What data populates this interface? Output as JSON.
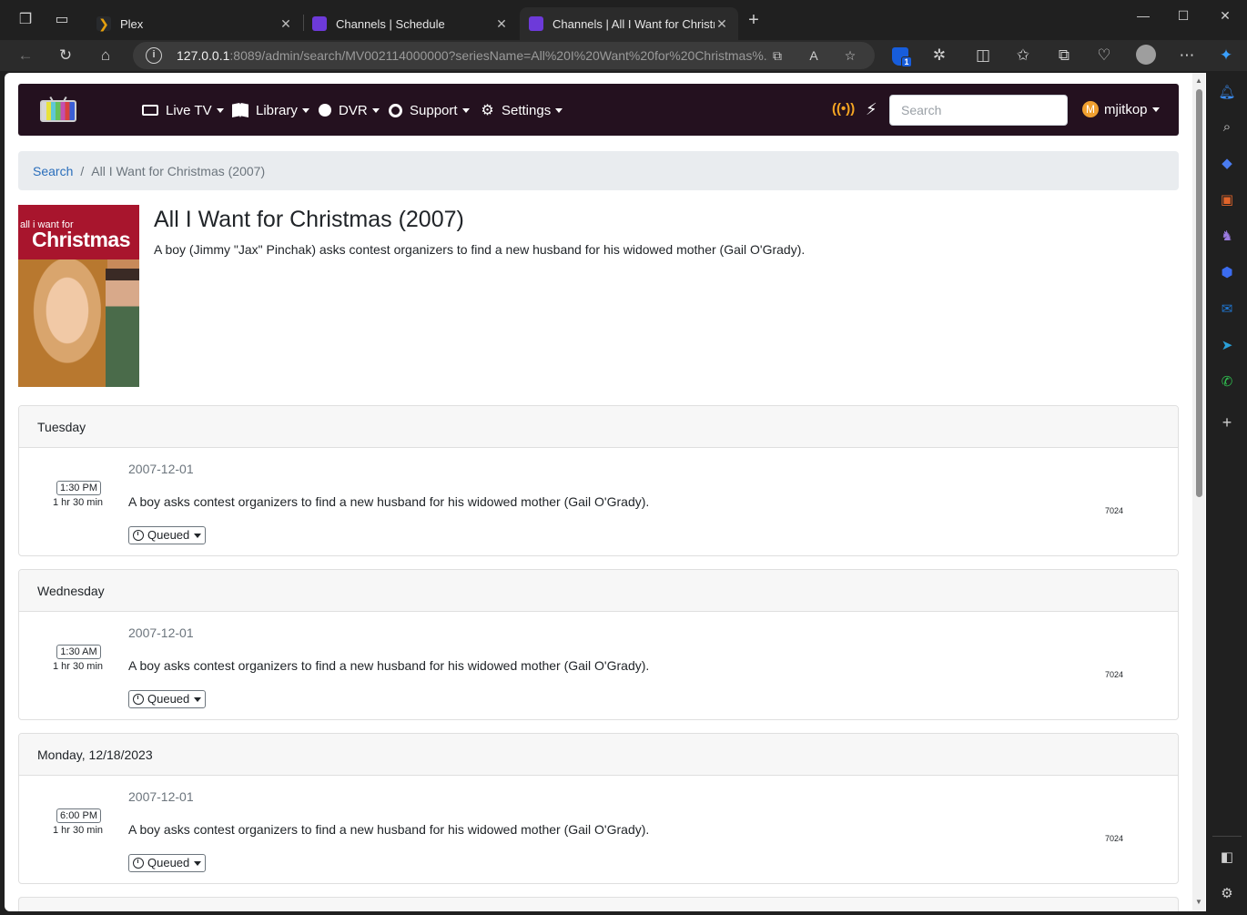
{
  "browser": {
    "tabs": [
      {
        "title": "Plex",
        "fav_color": "#282a2d"
      },
      {
        "title": "Channels | Schedule",
        "fav_color": "#6d3ad9"
      },
      {
        "title": "Channels | All I Want for Christmas",
        "fav_color": "#6d3ad9"
      }
    ],
    "url_host": "127.0.0.1",
    "url_rest": ":8089/admin/search/MV002114000000?seriesName=All%20I%20Want%20for%20Christmas%...",
    "bitwarden_badge": "1"
  },
  "navbar": {
    "items": [
      "Live TV",
      "Library",
      "DVR",
      "Support",
      "Settings"
    ],
    "search_placeholder": "Search",
    "user": {
      "initial": "M",
      "name": "mjitkop"
    }
  },
  "breadcrumb": {
    "parent": "Search",
    "current": "All I Want for Christmas (2007)"
  },
  "show": {
    "title": "All I Want for Christmas (2007)",
    "description": "A boy (Jimmy \"Jax\" Pinchak) asks contest organizers to find a new husband for his widowed mother (Gail O'Grady).",
    "poster_line1": "all i want for",
    "poster_line2": "Christmas"
  },
  "airings": [
    {
      "day": "Tuesday",
      "time": "1:30 PM",
      "duration": "1 hr 30 min",
      "date": "2007-12-01",
      "description": "A boy asks contest organizers to find a new husband for his widowed mother (Gail O'Grady).",
      "status": "Queued",
      "channel": "7024"
    },
    {
      "day": "Wednesday",
      "time": "1:30 AM",
      "duration": "1 hr 30 min",
      "date": "2007-12-01",
      "description": "A boy asks contest organizers to find a new husband for his widowed mother (Gail O'Grady).",
      "status": "Queued",
      "channel": "7024"
    },
    {
      "day": "Monday, 12/18/2023",
      "time": "6:00 PM",
      "duration": "1 hr 30 min",
      "date": "2007-12-01",
      "description": "A boy asks contest organizers to find a new husband for his widowed mother (Gail O'Grady).",
      "status": "Queued",
      "channel": "7024"
    }
  ],
  "colors": {
    "navbar_bg": "#24111f",
    "link": "#2a6ebb",
    "live_indicator": "#f5a623"
  }
}
